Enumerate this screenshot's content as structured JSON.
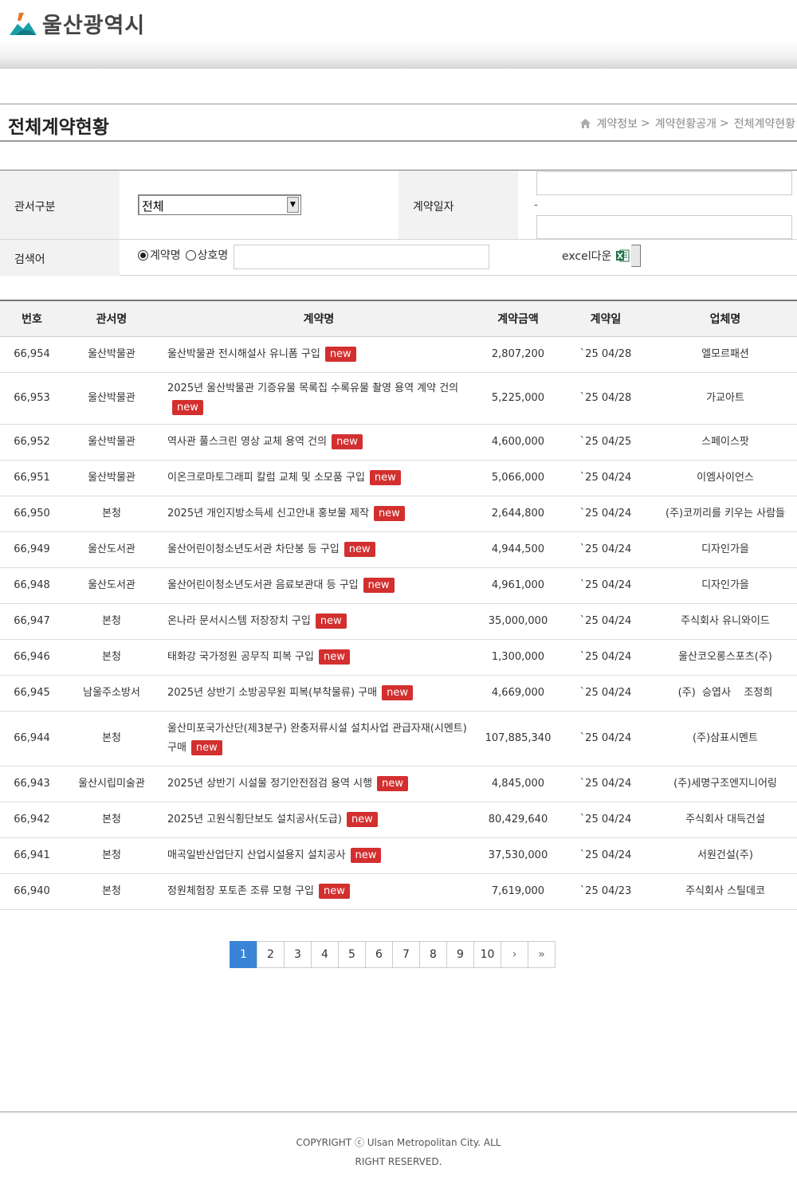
{
  "header": {
    "logo_text": "울산광역시"
  },
  "page": {
    "title": "전체계약현황",
    "breadcrumb": [
      "계약정보",
      "계약현황공개",
      "전체계약현황"
    ]
  },
  "search": {
    "dept_label": "관서구분",
    "dept_value": "전체",
    "date_label": "계약일자",
    "date_sep": "-",
    "keyword_label": "검색어",
    "radio_options": [
      "계약명",
      "상호명"
    ],
    "radio_selected": "계약명",
    "excel_label": "excel다운"
  },
  "table": {
    "headers": [
      "번호",
      "관서명",
      "계약명",
      "계약금액",
      "계약일",
      "업체명"
    ],
    "badge_text": "new",
    "rows": [
      {
        "no": "66,954",
        "dept": "울산박물관",
        "name": "울산박물관 전시해설사 유니폼 구입",
        "amount": "2,807,200",
        "date": "`25 04/28",
        "company": "엘모르패션"
      },
      {
        "no": "66,953",
        "dept": "울산박물관",
        "name": "2025년 울산박물관 기증유물 목록집 수록유물 촬영 용역 계약 건의",
        "amount": "5,225,000",
        "date": "`25 04/28",
        "company": "가교아트"
      },
      {
        "no": "66,952",
        "dept": "울산박물관",
        "name": "역사관 풀스크린 영상 교체 용역 건의",
        "amount": "4,600,000",
        "date": "`25 04/25",
        "company": "스페이스팟"
      },
      {
        "no": "66,951",
        "dept": "울산박물관",
        "name": "이온크로마토그래피 칼럼 교체 및 소모품 구입",
        "amount": "5,066,000",
        "date": "`25 04/24",
        "company": "이엠사이언스"
      },
      {
        "no": "66,950",
        "dept": "본청",
        "name": "2025년 개인지방소득세 신고안내 홍보물 제작",
        "amount": "2,644,800",
        "date": "`25 04/24",
        "company": "(주)코끼리를 키우는 사람들"
      },
      {
        "no": "66,949",
        "dept": "울산도서관",
        "name": "울산어린이청소년도서관 차단봉 등 구입",
        "amount": "4,944,500",
        "date": "`25 04/24",
        "company": "디자인가을"
      },
      {
        "no": "66,948",
        "dept": "울산도서관",
        "name": "울산어린이청소년도서관 음료보관대 등 구입",
        "amount": "4,961,000",
        "date": "`25 04/24",
        "company": "디자인가을"
      },
      {
        "no": "66,947",
        "dept": "본청",
        "name": "온나라 문서시스템 저장장치 구입",
        "amount": "35,000,000",
        "date": "`25 04/24",
        "company": "주식회사 유니와이드"
      },
      {
        "no": "66,946",
        "dept": "본청",
        "name": "태화강 국가정원 공무직 피복 구입",
        "amount": "1,300,000",
        "date": "`25 04/24",
        "company": "울산코오롱스포츠(주)"
      },
      {
        "no": "66,945",
        "dept": "남울주소방서",
        "name": "2025년 상반기 소방공무원 피복(부착물류) 구매",
        "amount": "4,669,000",
        "date": "`25 04/24",
        "company": "(주)  승엽사    조정희"
      },
      {
        "no": "66,944",
        "dept": "본청",
        "name": "울산미포국가산단(제3분구) 완충저류시설 설치사업 관급자재(시멘트) 구매",
        "amount": "107,885,340",
        "date": "`25 04/24",
        "company": "(주)삼표시멘트"
      },
      {
        "no": "66,943",
        "dept": "울산시립미술관",
        "name": "2025년 상반기 시설물 정기안전점검 용역 시행",
        "amount": "4,845,000",
        "date": "`25 04/24",
        "company": "(주)세명구조엔지니어링"
      },
      {
        "no": "66,942",
        "dept": "본청",
        "name": "2025년 고원식횡단보도 설치공사(도급)",
        "amount": "80,429,640",
        "date": "`25 04/24",
        "company": "주식회사 대득건설"
      },
      {
        "no": "66,941",
        "dept": "본청",
        "name": "매곡일반산업단지 산업시설용지 설치공사",
        "amount": "37,530,000",
        "date": "`25 04/24",
        "company": "서원건설(주)"
      },
      {
        "no": "66,940",
        "dept": "본청",
        "name": "정원체험장 포토존 조류 모형 구입",
        "amount": "7,619,000",
        "date": "`25 04/23",
        "company": "주식회사 스틸데코"
      }
    ]
  },
  "pagination": {
    "pages": [
      "1",
      "2",
      "3",
      "4",
      "5",
      "6",
      "7",
      "8",
      "9",
      "10"
    ],
    "current": "1",
    "next": "›",
    "last": "»"
  },
  "footer": {
    "copyright": "COPYRIGHT ⓒ Ulsan Metropolitan City. ALL RIGHT RESERVED."
  },
  "colors": {
    "accent": "#3a84d8",
    "badge": "#d32f2f",
    "logo_teal": "#1a9fa8"
  }
}
